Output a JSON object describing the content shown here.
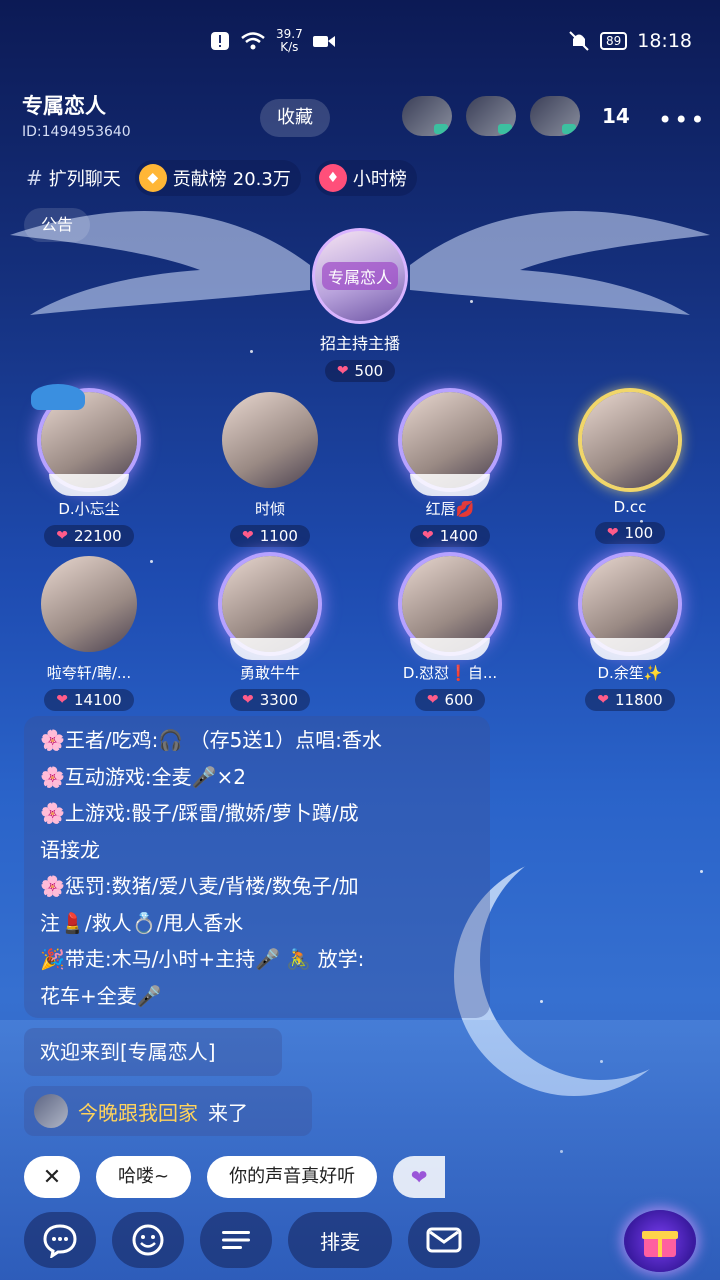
{
  "status_bar": {
    "net_speed_value": "39.7",
    "net_speed_unit": "K/s",
    "battery": "89",
    "time": "18:18"
  },
  "room": {
    "name": "专属恋人",
    "id": "ID:1494953640",
    "favorite_label": "收藏",
    "online_count": "14"
  },
  "tags": {
    "category": "扩列聊天",
    "contribution_label": "贡献榜",
    "contribution_value": "20.3万",
    "hourly_label": "小时榜"
  },
  "notice_label": "公告",
  "host": {
    "logo_text": "专属恋人",
    "name": "招主持主播",
    "hearts": "500"
  },
  "seats": [
    {
      "name": "D.小忘尘",
      "hearts": "22100"
    },
    {
      "name": "时倾",
      "hearts": "1100"
    },
    {
      "name": "红唇💋",
      "hearts": "1400"
    },
    {
      "name": "D.cc",
      "hearts": "100"
    },
    {
      "name": "啦夸轩/聘/...",
      "hearts": "14100"
    },
    {
      "name": "勇敢牛牛",
      "hearts": "3300"
    },
    {
      "name": "D.怼怼❗自...",
      "hearts": "600"
    },
    {
      "name": "D.余笙✨",
      "hearts": "11800"
    }
  ],
  "announcement": {
    "line1": "🌸王者/吃鸡:🎧 （存5送1）点唱:香水",
    "line2": "🌸互动游戏:全麦🎤×2",
    "line3": "🌸上游戏:骰子/踩雷/撒娇/萝卜蹲/成",
    "line4": "语接龙",
    "line5": "🌸惩罚:数猪/爱八麦/背楼/数兔子/加",
    "line6": "注💄/救人💍/甩人香水",
    "line7": "🎉带走:木马/小时+主持🎤 🚴 放学:",
    "line8": "花车+全麦🎤"
  },
  "welcome": "欢迎来到[专属恋人]",
  "join": {
    "user": "今晚跟我回家",
    "action": "来了"
  },
  "quick_replies": {
    "close": "✕",
    "chip1": "哈喽~",
    "chip2": "你的声音真好听"
  },
  "bottom_bar": {
    "queue_label": "排麦"
  },
  "colors": {
    "heart": "#ff5c8a",
    "join_user": "#ffd35c",
    "frame": "#b7a2ff"
  }
}
